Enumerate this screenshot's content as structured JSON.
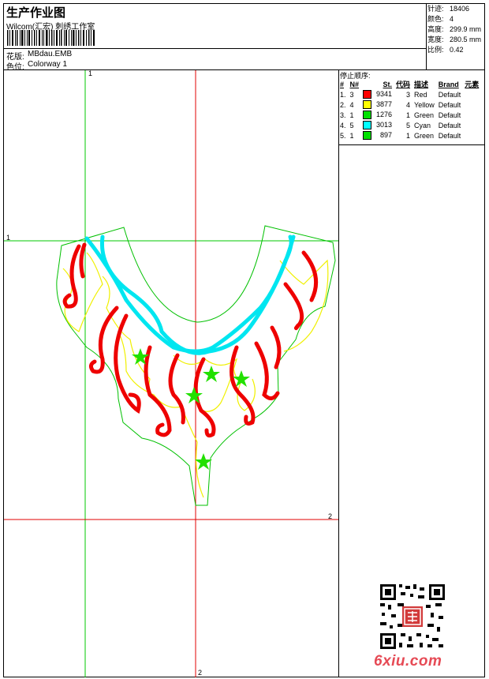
{
  "header": {
    "title": "生产作业图",
    "subtitle": "Wilcom(汇宏) 刺绣工作室",
    "design_label": "花版:",
    "design_value": "MBdau.EMB",
    "colorway_label": "色位:",
    "colorway_value": "Colorway 1"
  },
  "specs": {
    "stitches_label": "针迹:",
    "stitches_value": "18406",
    "colors_label": "颜色:",
    "colors_value": "4",
    "height_label": "高度:",
    "height_value": "299.9 mm",
    "width_label": "宽度:",
    "width_value": "280.5 mm",
    "scale_label": "比例:",
    "scale_value": "0.42"
  },
  "stop_sequence": {
    "title": "停止顺序:",
    "headers": [
      "#",
      "N#",
      "St.",
      "代码",
      "描述",
      "Brand",
      "元素"
    ],
    "rows": [
      {
        "idx": "1.",
        "n": "3",
        "color": "#ff0000",
        "st": "9341",
        "code": "3",
        "desc": "Red",
        "brand": "Default"
      },
      {
        "idx": "2.",
        "n": "4",
        "color": "#ffff00",
        "st": "3877",
        "code": "4",
        "desc": "Yellow",
        "brand": "Default"
      },
      {
        "idx": "3.",
        "n": "1",
        "color": "#00e000",
        "st": "1276",
        "code": "1",
        "desc": "Green",
        "brand": "Default"
      },
      {
        "idx": "4.",
        "n": "5",
        "color": "#00ffff",
        "st": "3013",
        "code": "5",
        "desc": "Cyan",
        "brand": "Default"
      },
      {
        "idx": "5.",
        "n": "1",
        "color": "#00e000",
        "st": "897",
        "code": "1",
        "desc": "Green",
        "brand": "Default"
      }
    ]
  },
  "axes": {
    "green_v": "1",
    "green_h": "1",
    "red_h": "2",
    "red_v": "2"
  },
  "watermark": "6xiu.com",
  "colors": {
    "red": "#ff0000",
    "yellow": "#ffff00",
    "green": "#00e000",
    "cyan": "#00e6f0",
    "outline": "#00c000"
  },
  "icons": {
    "qr": "qr-code-icon",
    "barcode": "barcode-icon"
  }
}
